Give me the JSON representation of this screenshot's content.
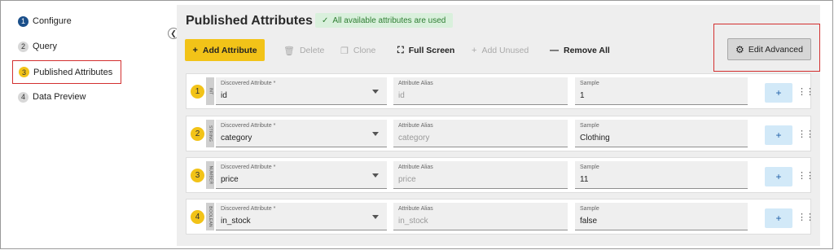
{
  "sidebar": {
    "steps": [
      {
        "num": "1",
        "label": "Configure"
      },
      {
        "num": "2",
        "label": "Query"
      },
      {
        "num": "3",
        "label": "Published Attributes"
      },
      {
        "num": "4",
        "label": "Data Preview"
      }
    ],
    "collapse_icon": "chevron-left-icon"
  },
  "header": {
    "title": "Published Attributes",
    "status_message": "All available attributes are used"
  },
  "toolbar": {
    "add_label": "Add Attribute",
    "delete_label": "Delete",
    "clone_label": "Clone",
    "fullscreen_label": "Full Screen",
    "add_unused_label": "Add Unused",
    "remove_all_label": "Remove All",
    "edit_advanced_label": "Edit Advanced"
  },
  "field_labels": {
    "discovered": "Discovered Attribute *",
    "alias": "Attribute Alias",
    "sample": "Sample"
  },
  "rows": [
    {
      "num": "1",
      "type": "INT",
      "discovered": "id",
      "alias": "id",
      "sample": "1"
    },
    {
      "num": "2",
      "type": "STRING",
      "discovered": "category",
      "alias": "category",
      "sample": "Clothing"
    },
    {
      "num": "3",
      "type": "NUMBER",
      "discovered": "price",
      "alias": "price",
      "sample": "11"
    },
    {
      "num": "4",
      "type": "BOOLEAN",
      "discovered": "in_stock",
      "alias": "in_stock",
      "sample": "false"
    }
  ],
  "colors": {
    "accent": "#f2c318",
    "step_done": "#1b4f8a",
    "success_bg": "#d9f0dc",
    "success_text": "#2e7d32",
    "highlight": "#d32f2f"
  }
}
